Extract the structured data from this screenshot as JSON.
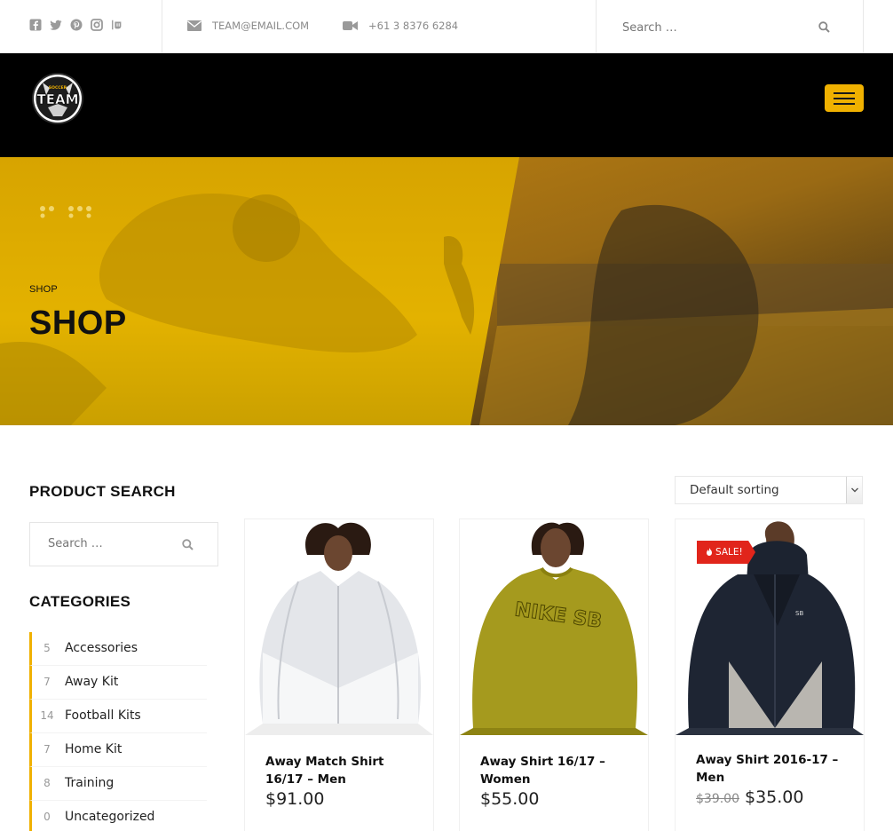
{
  "topbar": {
    "social_icons": [
      "facebook-icon",
      "twitter-icon",
      "pinterest-icon",
      "instagram-icon",
      "other-social-icon"
    ],
    "email": "TEAM@EMAIL.COM",
    "phone": "+61 3 8376 6284",
    "search_placeholder": "Search …"
  },
  "header": {
    "logo_top": "SOCCER",
    "logo_text": "TEAM",
    "accent_color": "#f0b100"
  },
  "hero": {
    "breadcrumb": "SHOP",
    "title": "SHOP"
  },
  "sidebar": {
    "search_title": "PRODUCT SEARCH",
    "search_placeholder": "Search …",
    "categories_title": "CATEGORIES",
    "categories": [
      {
        "count": "5",
        "name": "Accessories"
      },
      {
        "count": "7",
        "name": "Away Kit"
      },
      {
        "count": "14",
        "name": "Football Kits"
      },
      {
        "count": "7",
        "name": "Home Kit"
      },
      {
        "count": "8",
        "name": "Training"
      },
      {
        "count": "0",
        "name": "Uncategorized"
      }
    ]
  },
  "sorting": {
    "selected": "Default sorting"
  },
  "products": [
    {
      "name": "Away Match Shirt 16/17 – Men",
      "price": "$91.00",
      "old_price": "",
      "sale": ""
    },
    {
      "name": "Away Shirt 16/17 – Women",
      "price": "$55.00",
      "old_price": "",
      "sale": ""
    },
    {
      "name": "Away Shirt 2016-17 – Men",
      "price": "$35.00",
      "old_price": "$39.00",
      "sale": "SALE!"
    }
  ]
}
